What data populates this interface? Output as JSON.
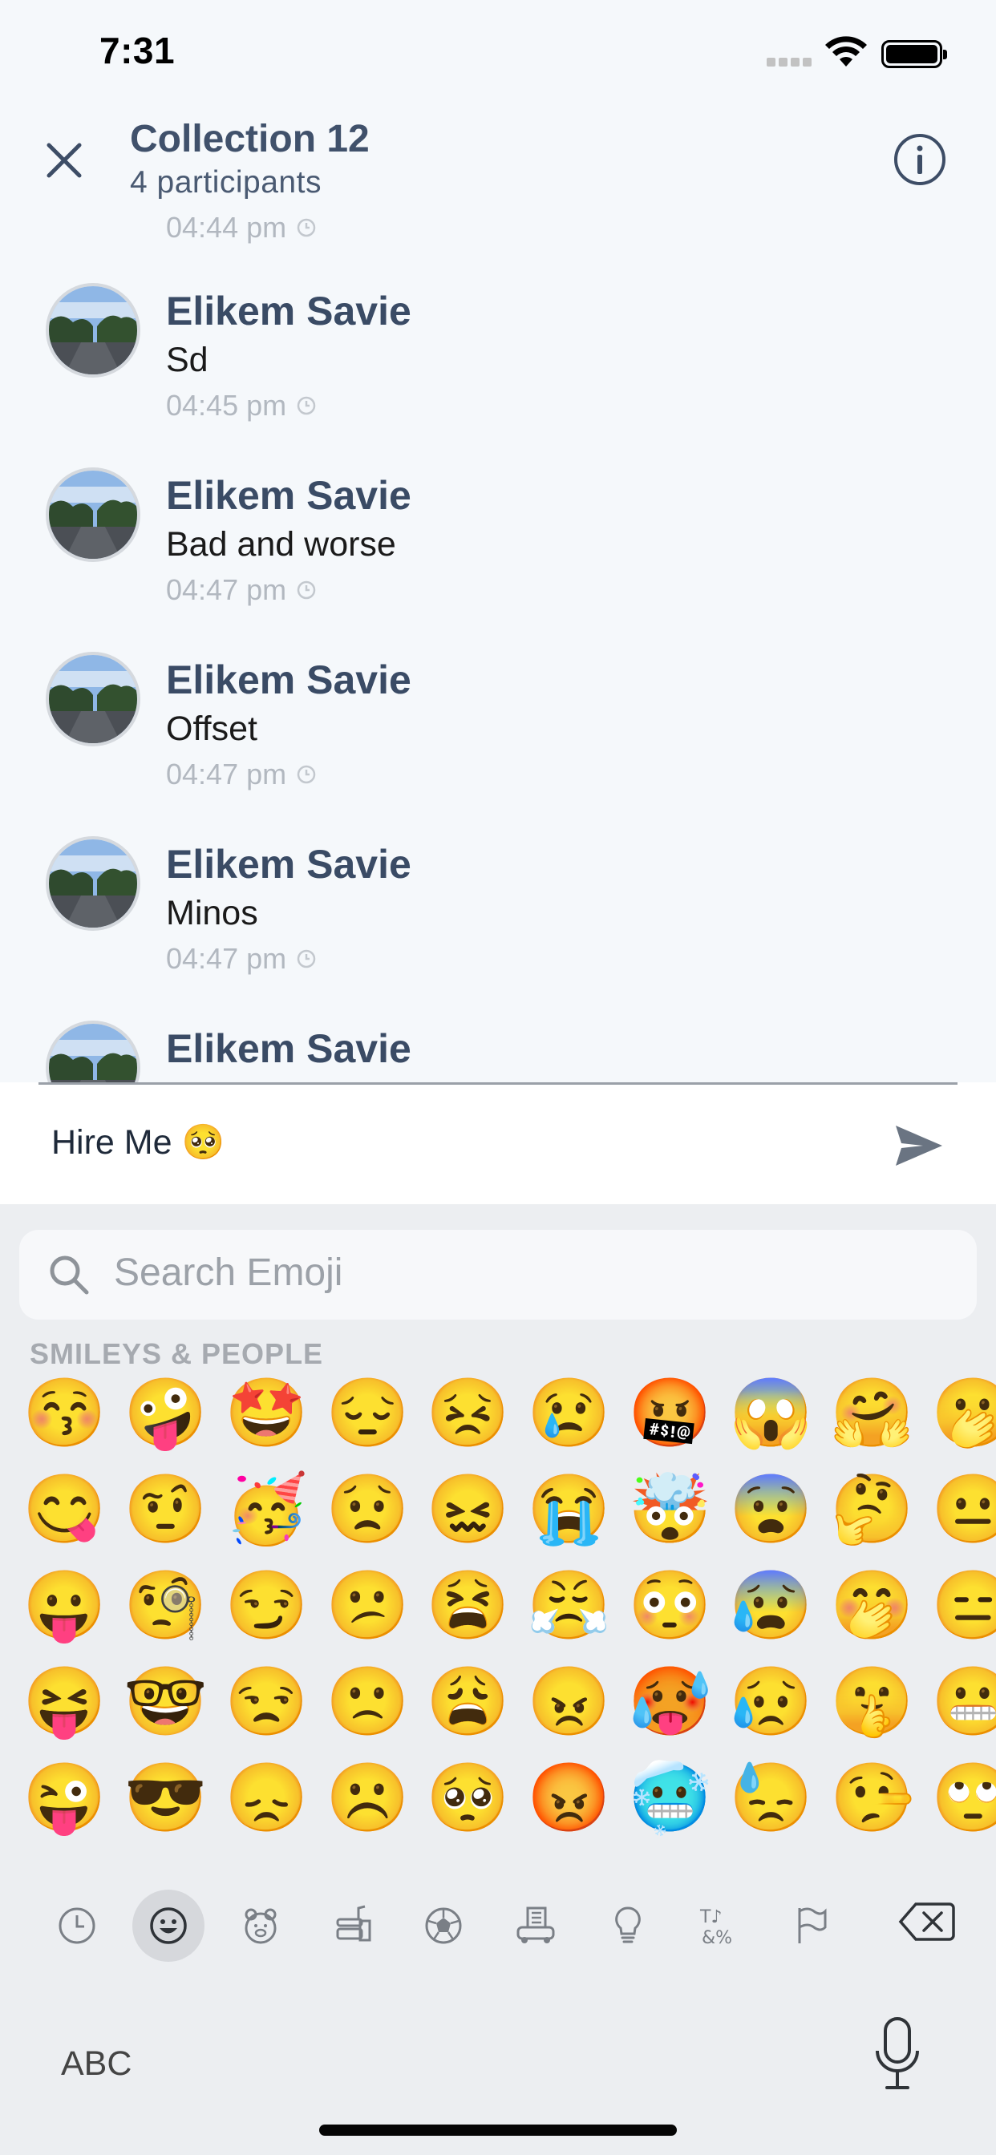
{
  "status_bar": {
    "time": "7:31"
  },
  "header": {
    "title": "Collection 12",
    "subtitle": "4 participants"
  },
  "messages": {
    "top_partial_time": "04:44 pm",
    "items": [
      {
        "name": "Elikem Savie",
        "text": "Sd",
        "time": "04:45 pm"
      },
      {
        "name": "Elikem Savie",
        "text": "Bad and worse",
        "time": "04:47 pm"
      },
      {
        "name": "Elikem Savie",
        "text": "Offset",
        "time": "04:47 pm"
      },
      {
        "name": "Elikem Savie",
        "text": "Minos",
        "time": "04:47 pm"
      },
      {
        "name": "Elikem Savie",
        "text": "",
        "time": ""
      }
    ]
  },
  "compose": {
    "value": "Hire Me 🥺"
  },
  "keyboard": {
    "search_placeholder": "Search Emoji",
    "section_label": "SMILEYS & PEOPLE",
    "emoji_rows": [
      [
        "😚",
        "🤪",
        "🤩",
        "😔",
        "😣",
        "😢",
        "🤬",
        "😱",
        "🤗",
        "🫢"
      ],
      [
        "😋",
        "🤨",
        "🥳",
        "😟",
        "😖",
        "😭",
        "🤯",
        "😨",
        "🤔",
        "😐"
      ],
      [
        "😛",
        "🧐",
        "😏",
        "😕",
        "😫",
        "😤",
        "😳",
        "😰",
        "🤭",
        "😑"
      ],
      [
        "😝",
        "🤓",
        "😒",
        "🙁",
        "😩",
        "😠",
        "🥵",
        "😥",
        "🤫",
        "😬"
      ],
      [
        "😜",
        "😎",
        "😞",
        "☹️",
        "🥺",
        "😡",
        "🥶",
        "😓",
        "🤥",
        "🙄"
      ]
    ],
    "categories": [
      "recent-icon",
      "smiley-icon",
      "animal-icon",
      "food-icon",
      "sports-icon",
      "travel-icon",
      "objects-icon",
      "symbols-icon",
      "flags-icon"
    ],
    "abc_label": "ABC"
  }
}
